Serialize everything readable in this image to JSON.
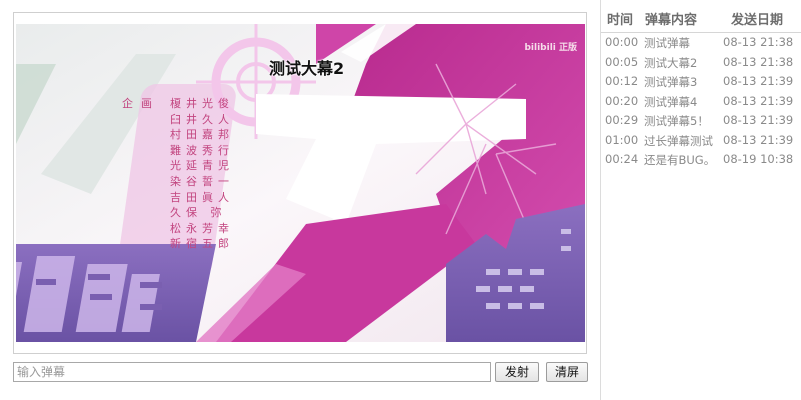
{
  "player": {
    "live_danmaku": "测试大幕2",
    "watermark": "bilibili 正版",
    "credits": {
      "role": "企画",
      "names": [
        "榎井光俊",
        "臼井久人",
        "村田嘉邦",
        "難波秀行",
        "光延青児",
        "染谷誓一",
        "吉田眞人",
        "久保 弥",
        "松永芳幸",
        "新宿五郎"
      ]
    }
  },
  "input": {
    "placeholder": "输入弹幕",
    "value": ""
  },
  "buttons": {
    "fire": "发射",
    "clear": "清屏"
  },
  "list": {
    "headers": {
      "time": "时间",
      "content": "弹幕内容",
      "date": "发送日期"
    },
    "rows": [
      {
        "time": "00:00",
        "text": "测试弹幕",
        "date": "08-13 21:38"
      },
      {
        "time": "00:05",
        "text": "测试大幕2",
        "date": "08-13 21:38"
      },
      {
        "time": "00:12",
        "text": "测试弹幕3",
        "date": "08-13 21:39"
      },
      {
        "time": "00:20",
        "text": "测试弹幕4",
        "date": "08-13 21:39"
      },
      {
        "time": "00:29",
        "text": "测试弹幕5！",
        "date": "08-13 21:39"
      },
      {
        "time": "01:00",
        "text": "过长弹幕测试",
        "date": "08-13 21:39"
      },
      {
        "time": "00:24",
        "text": "还是有BUG。",
        "date": "08-19 10:38"
      }
    ]
  },
  "colors": {
    "magenta": "#c6359a",
    "purple": "#7a5fb0",
    "credits": "#c2447f"
  }
}
